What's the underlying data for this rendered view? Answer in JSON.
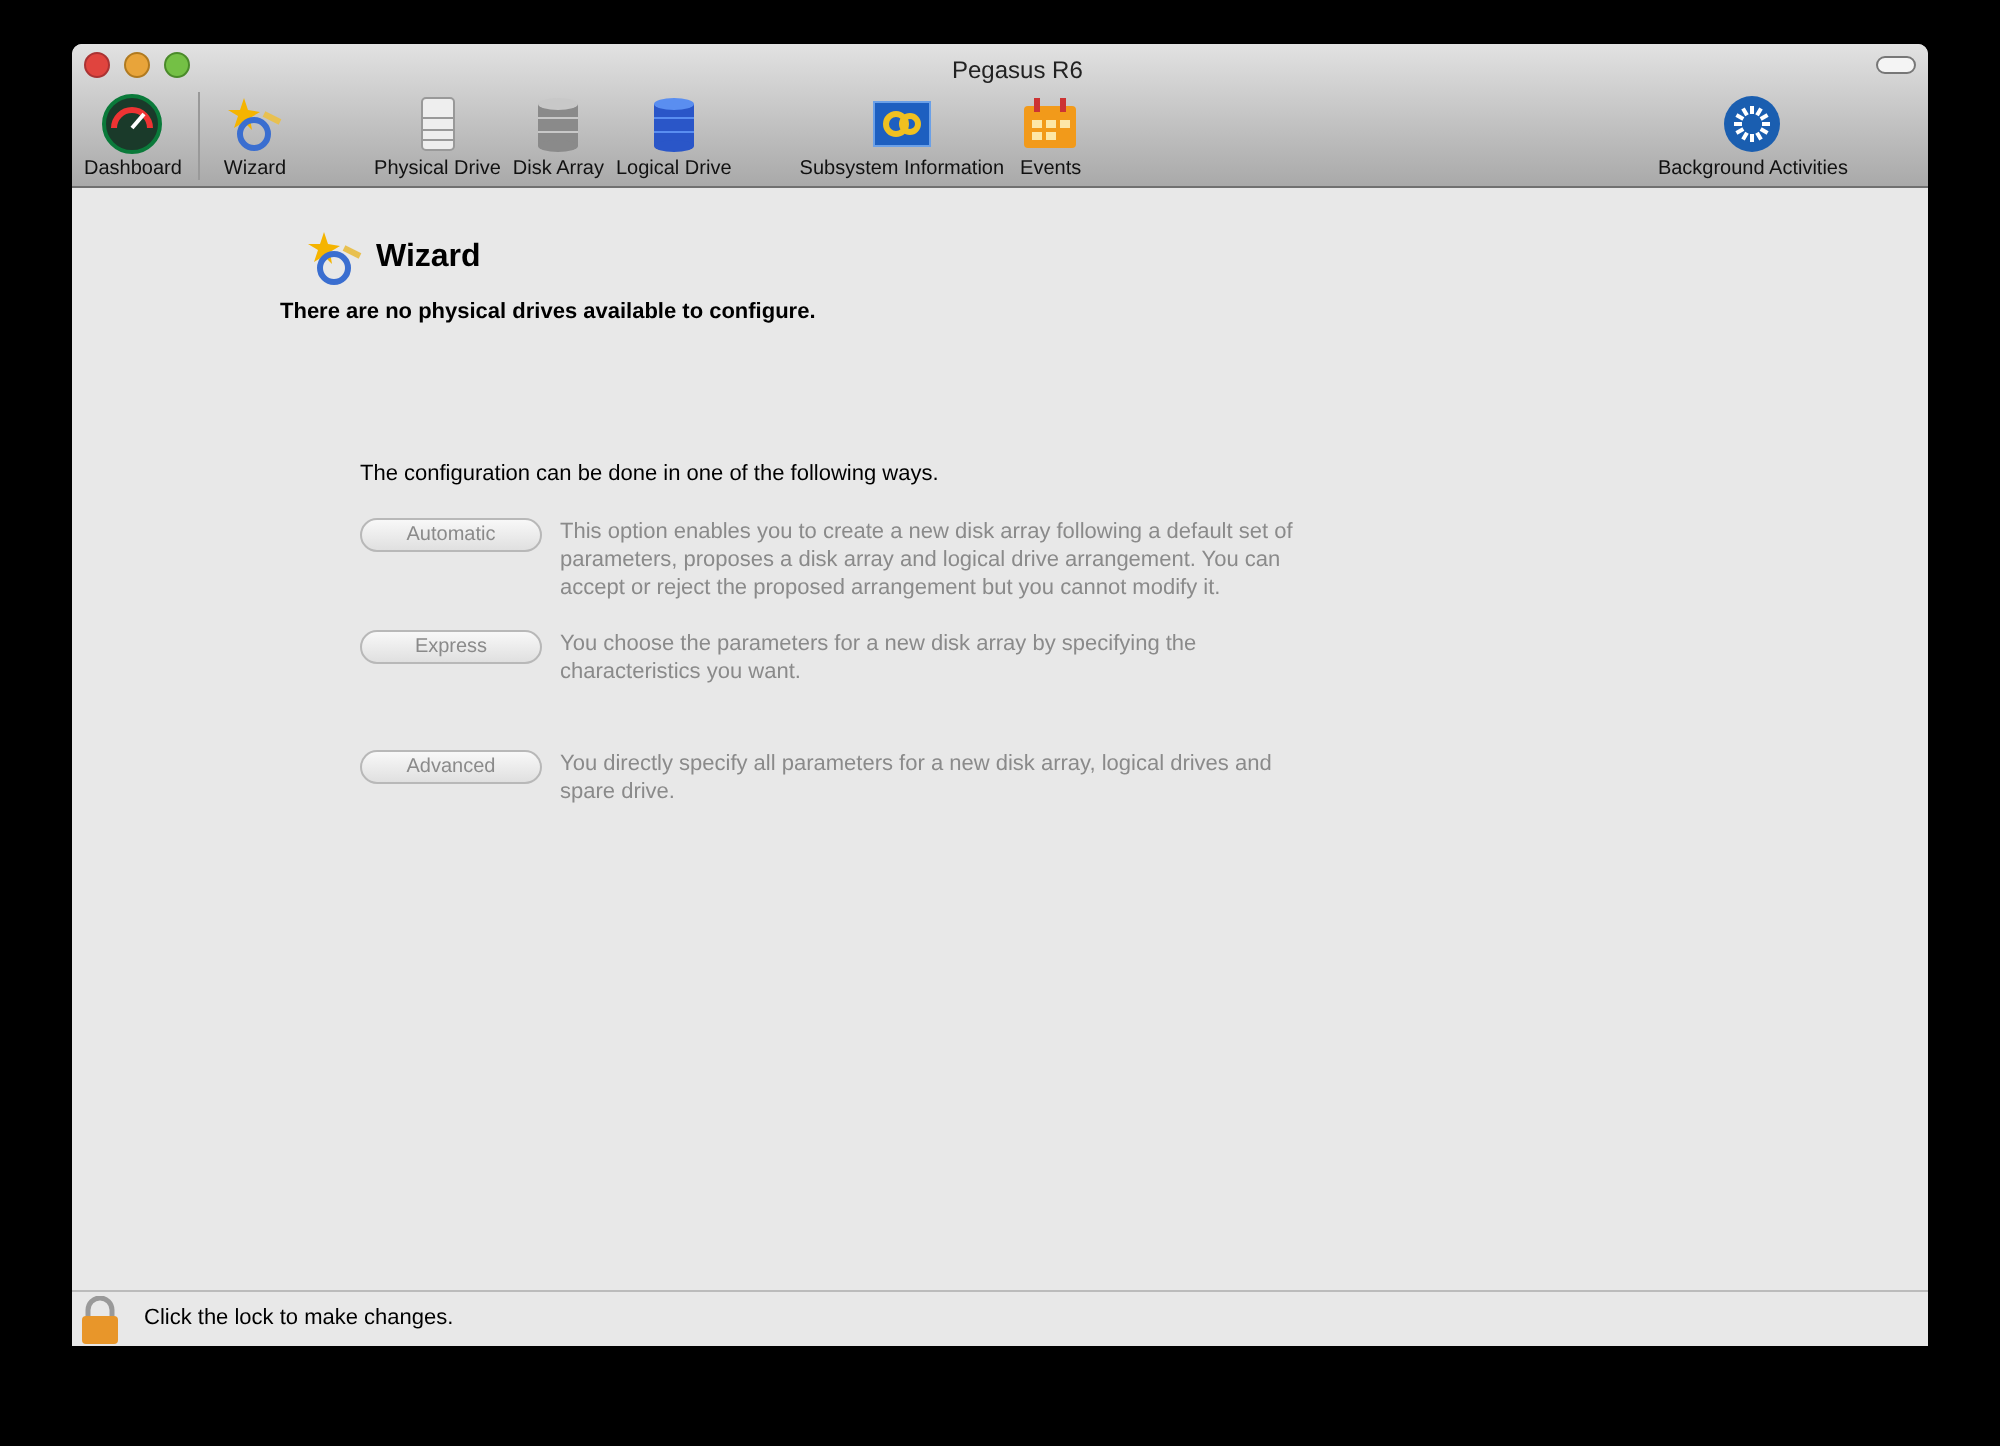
{
  "window": {
    "title": "Pegasus R6"
  },
  "toolbar": [
    {
      "label": "Dashboard",
      "kind": "gauge"
    },
    {
      "label": "Wizard",
      "kind": "wizard"
    },
    {
      "label": "Physical Drive",
      "kind": "drive"
    },
    {
      "label": "Disk Array",
      "kind": "array"
    },
    {
      "label": "Logical Drive",
      "kind": "logical"
    },
    {
      "label": "Subsystem Information",
      "kind": "info"
    },
    {
      "label": "Events",
      "kind": "calendar"
    },
    {
      "label": "Background Activities",
      "kind": "activity"
    }
  ],
  "page": {
    "title": "Wizard",
    "message": "There are no physical drives available to configure.",
    "intro": "The configuration can be done in one of the following ways."
  },
  "options": [
    {
      "label": "Automatic",
      "disabled": true,
      "description": "This option enables you to create a new disk array following a default set of parameters, proposes a disk array and logical drive arrangement. You can accept or reject the proposed arrangement but you cannot modify it."
    },
    {
      "label": "Express",
      "disabled": true,
      "description": "You choose the parameters for a new disk array by specifying the characteristics you want."
    },
    {
      "label": "Advanced",
      "disabled": true,
      "description": "You directly specify all parameters for a new disk array, logical drives and spare drive."
    }
  ],
  "status_bar": {
    "text": "Click the lock to make changes."
  }
}
